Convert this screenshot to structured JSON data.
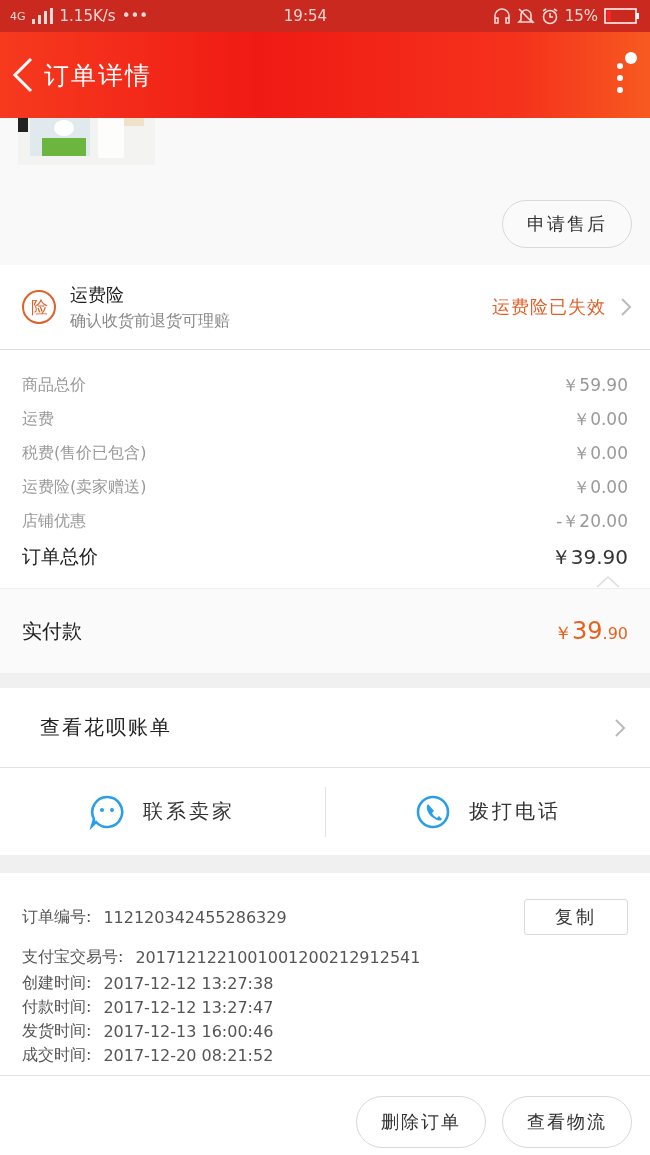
{
  "status_bar": {
    "network": "4G",
    "speed": "1.15K/s",
    "more": "•••",
    "time": "19:54",
    "battery": "15%"
  },
  "header": {
    "title": "订单详情"
  },
  "product": {
    "after_sale_button": "申请售后"
  },
  "insurance": {
    "badge": "险",
    "title": "运费险",
    "subtitle": "确认收货前退货可理赔",
    "status": "运费险已失效"
  },
  "price_rows": [
    {
      "label": "商品总价",
      "value": "￥59.90"
    },
    {
      "label": "运费",
      "value": "￥0.00"
    },
    {
      "label": "税费(售价已包含)",
      "value": "￥0.00"
    },
    {
      "label": "运费险(卖家赠送)",
      "value": "￥0.00"
    },
    {
      "label": "店铺优惠",
      "value": "-￥20.00"
    }
  ],
  "order_total": {
    "label": "订单总价",
    "value": "￥39.90"
  },
  "paid": {
    "label": "实付款",
    "currency": "￥",
    "amount_main": "39",
    "amount_fraction": ".90"
  },
  "huabei": {
    "label": "查看花呗账单"
  },
  "contact": [
    {
      "kind": "chat",
      "label": "联系卖家"
    },
    {
      "kind": "phone",
      "label": "拨打电话"
    }
  ],
  "order_info": {
    "number_label": "订单编号:",
    "number": "112120342455286329",
    "copy_button": "复制",
    "rows": [
      {
        "label": "支付宝交易号:",
        "value": "2017121221001001200212912541"
      },
      {
        "label": "创建时间:",
        "value": "2017-12-12 13:27:38"
      },
      {
        "label": "付款时间:",
        "value": "2017-12-12 13:27:47"
      },
      {
        "label": "发货时间:",
        "value": "2017-12-13 16:00:46"
      },
      {
        "label": "成交时间:",
        "value": "2017-12-20 08:21:52"
      }
    ]
  },
  "actions": [
    "删除订单",
    "查看物流"
  ]
}
